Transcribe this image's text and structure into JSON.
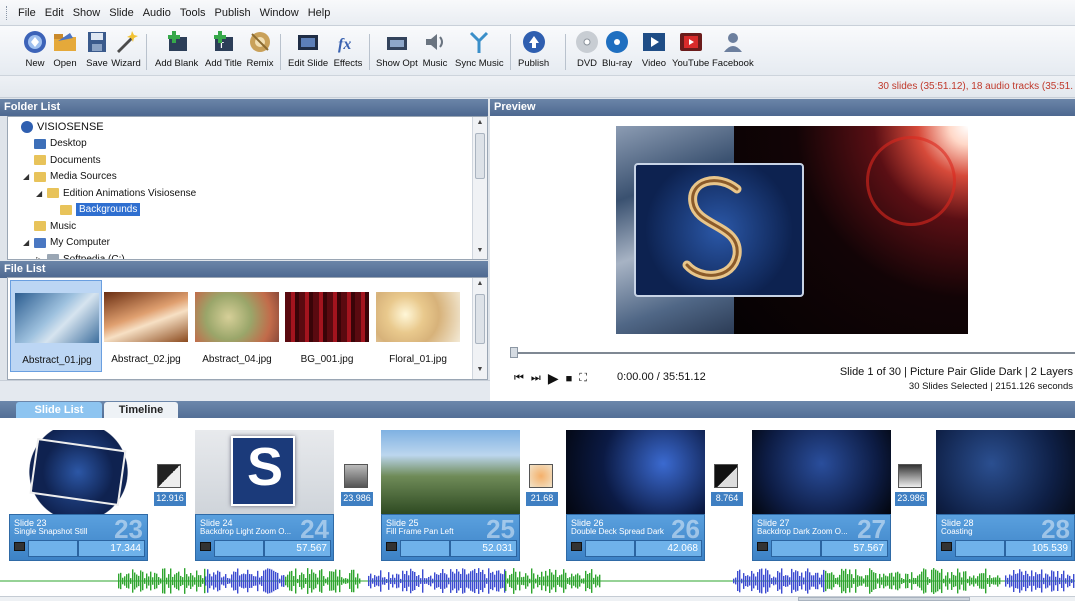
{
  "menu": [
    "File",
    "Edit",
    "Show",
    "Slide",
    "Audio",
    "Tools",
    "Publish",
    "Window",
    "Help"
  ],
  "toolbar": {
    "buttons": [
      {
        "label": "New",
        "icon": "new-show-icon"
      },
      {
        "label": "Open",
        "icon": "open-folder-icon"
      },
      {
        "label": "Save",
        "icon": "save-disk-icon"
      },
      {
        "label": "Wizard",
        "icon": "wizard-wand-icon"
      },
      {
        "label": "Add Blank",
        "icon": "add-blank-icon"
      },
      {
        "label": "Add Title",
        "icon": "add-title-icon"
      },
      {
        "label": "Remix",
        "icon": "remix-icon"
      },
      {
        "label": "Edit Slide",
        "icon": "edit-slide-icon"
      },
      {
        "label": "Effects",
        "icon": "effects-fx-icon"
      },
      {
        "label": "Show Opt",
        "icon": "show-options-icon"
      },
      {
        "label": "Music",
        "icon": "music-speaker-icon"
      },
      {
        "label": "Sync Music",
        "icon": "sync-music-icon"
      },
      {
        "label": "Publish",
        "icon": "publish-icon"
      },
      {
        "label": "DVD",
        "icon": "dvd-disc-icon"
      },
      {
        "label": "Blu-ray",
        "icon": "bluray-disc-icon"
      },
      {
        "label": "Video",
        "icon": "video-icon"
      },
      {
        "label": "YouTube",
        "icon": "youtube-icon"
      },
      {
        "label": "Facebook",
        "icon": "facebook-icon"
      }
    ]
  },
  "status": {
    "summary": "30 slides (35:51.12), 18 audio tracks (35:51."
  },
  "folder_panel": {
    "title": "Folder List",
    "tree": [
      {
        "label": "VISIOSENSE",
        "depth": 0,
        "icon": "visiosense-icon",
        "expander": ""
      },
      {
        "label": "Desktop",
        "depth": 1,
        "icon": "desktop-icon",
        "expander": ""
      },
      {
        "label": "Documents",
        "depth": 1,
        "icon": "documents-icon",
        "expander": ""
      },
      {
        "label": "Media Sources",
        "depth": 1,
        "icon": "media-folder-icon",
        "expander": "◢"
      },
      {
        "label": "Edition Animations Visiosense",
        "depth": 2,
        "icon": "folder-icon",
        "expander": "◢"
      },
      {
        "label": "Backgrounds",
        "depth": 3,
        "icon": "folder-icon",
        "expander": "",
        "selected": true
      },
      {
        "label": "Music",
        "depth": 1,
        "icon": "music-folder-icon",
        "expander": ""
      },
      {
        "label": "My Computer",
        "depth": 1,
        "icon": "computer-icon",
        "expander": "◢"
      },
      {
        "label": "Softpedia (C:)",
        "depth": 2,
        "icon": "drive-icon",
        "expander": "▷"
      }
    ]
  },
  "file_panel": {
    "title": "File List",
    "files": [
      {
        "name": "Abstract_01.jpg",
        "selected": true
      },
      {
        "name": "Abstract_02.jpg",
        "selected": false
      },
      {
        "name": "Abstract_04.jpg",
        "selected": false
      },
      {
        "name": "BG_001.jpg",
        "selected": false
      },
      {
        "name": "Floral_01.jpg",
        "selected": false
      }
    ]
  },
  "preview": {
    "title": "Preview",
    "time": "0:00.00 / 35:51.12",
    "info_line1": "Slide 1 of 30  |  Picture Pair Glide Dark  |  2 Layers",
    "info_line2": "30 Slides Selected  |  2151.126 seconds",
    "progress": 0
  },
  "tabs": [
    {
      "label": "Slide List",
      "active": true
    },
    {
      "label": "Timeline",
      "active": false
    }
  ],
  "slides": [
    {
      "title": "Slide 23",
      "name": "Single Snapshot Still",
      "number": "23",
      "duration": "17.344"
    },
    {
      "title": "Slide 24",
      "name": "Backdrop Light Zoom O...",
      "number": "24",
      "duration": "57.567"
    },
    {
      "title": "Slide 25",
      "name": "Fill Frame Pan Left",
      "number": "25",
      "duration": "52.031"
    },
    {
      "title": "Slide 26",
      "name": "Double Deck Spread Dark",
      "number": "26",
      "duration": "42.068"
    },
    {
      "title": "Slide 27",
      "name": "Backdrop Dark Zoom O...",
      "number": "27",
      "duration": "57.567"
    },
    {
      "title": "Slide 28",
      "name": "Coasting",
      "number": "28",
      "duration": "105.539"
    }
  ],
  "transitions": [
    "12.916",
    "23.986",
    "21.68",
    "8.764",
    "23.986"
  ],
  "colors": {
    "panel_title": "#4d6890",
    "slide_info": "#3d82c6",
    "selection": "#2f6fd0",
    "status_text": "#c0392b",
    "audio_blue": "#3b4bd0",
    "audio_green": "#2ea52e"
  }
}
